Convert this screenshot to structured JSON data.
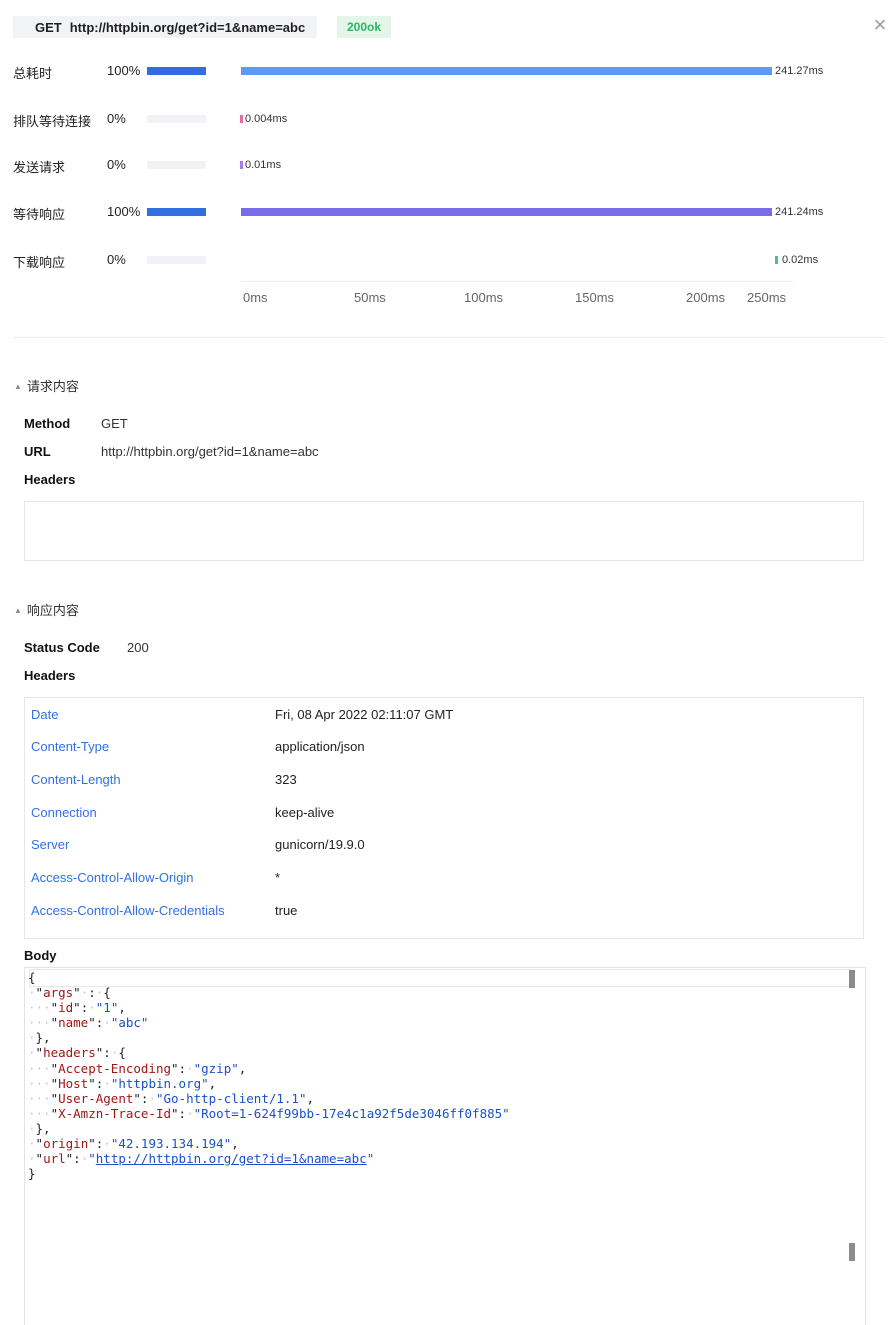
{
  "request_bar": {
    "method": "GET",
    "url": "http://httpbin.org/get?id=1&name=abc",
    "status": "200ok"
  },
  "close_label": "×",
  "timing": {
    "rows": [
      {
        "label": "总耗时",
        "percent": "100%",
        "fraction": 1.0,
        "value": "241.27ms",
        "color": "#5b9cf2"
      },
      {
        "label": "排队等待连接",
        "percent": "0%",
        "fraction": 0.0,
        "value": "0.004ms",
        "color": "#e76aa0"
      },
      {
        "label": "发送请求",
        "percent": "0%",
        "fraction": 0.0,
        "value": "0.01ms",
        "color": "#a57be6"
      },
      {
        "label": "等待响应",
        "percent": "100%",
        "fraction": 1.0,
        "value": "241.24ms",
        "color": "#7b6be8"
      },
      {
        "label": "下载响应",
        "percent": "0%",
        "fraction": 0.0,
        "value": "0.02ms",
        "color": "#4cc08a"
      }
    ],
    "axis_ticks": [
      "0ms",
      "50ms",
      "100ms",
      "150ms",
      "200ms",
      "250ms"
    ]
  },
  "request_section": {
    "title": "请求内容",
    "method_label": "Method",
    "method_value": "GET",
    "url_label": "URL",
    "url_value": "http://httpbin.org/get?id=1&name=abc",
    "headers_label": "Headers"
  },
  "response_section": {
    "title": "响应内容",
    "status_code_label": "Status Code",
    "status_code_value": "200",
    "headers_label": "Headers",
    "headers": [
      {
        "name": "Date",
        "value": "Fri, 08 Apr 2022 02:11:07 GMT"
      },
      {
        "name": "Content-Type",
        "value": "application/json"
      },
      {
        "name": "Content-Length",
        "value": "323"
      },
      {
        "name": "Connection",
        "value": "keep-alive"
      },
      {
        "name": "Server",
        "value": "gunicorn/19.9.0"
      },
      {
        "name": "Access-Control-Allow-Origin",
        "value": "*"
      },
      {
        "name": "Access-Control-Allow-Credentials",
        "value": "true"
      }
    ],
    "body_label": "Body",
    "body": {
      "args_key": "args",
      "id_key": "id",
      "id_val": "1",
      "name_key": "name",
      "name_val": "abc",
      "headers_key": "headers",
      "ae_key": "Accept-Encoding",
      "ae_val": "gzip",
      "host_key": "Host",
      "host_val": "httpbin.org",
      "ua_key": "User-Agent",
      "ua_val": "Go-http-client/1.1",
      "trace_key": "X-Amzn-Trace-Id",
      "trace_val": "Root=1-624f99bb-17e4c1a92f5de3046ff0f885",
      "origin_key": "origin",
      "origin_val": "42.193.134.194",
      "url_key": "url",
      "url_val": "http://httpbin.org/get?id=1&name=abc"
    }
  }
}
